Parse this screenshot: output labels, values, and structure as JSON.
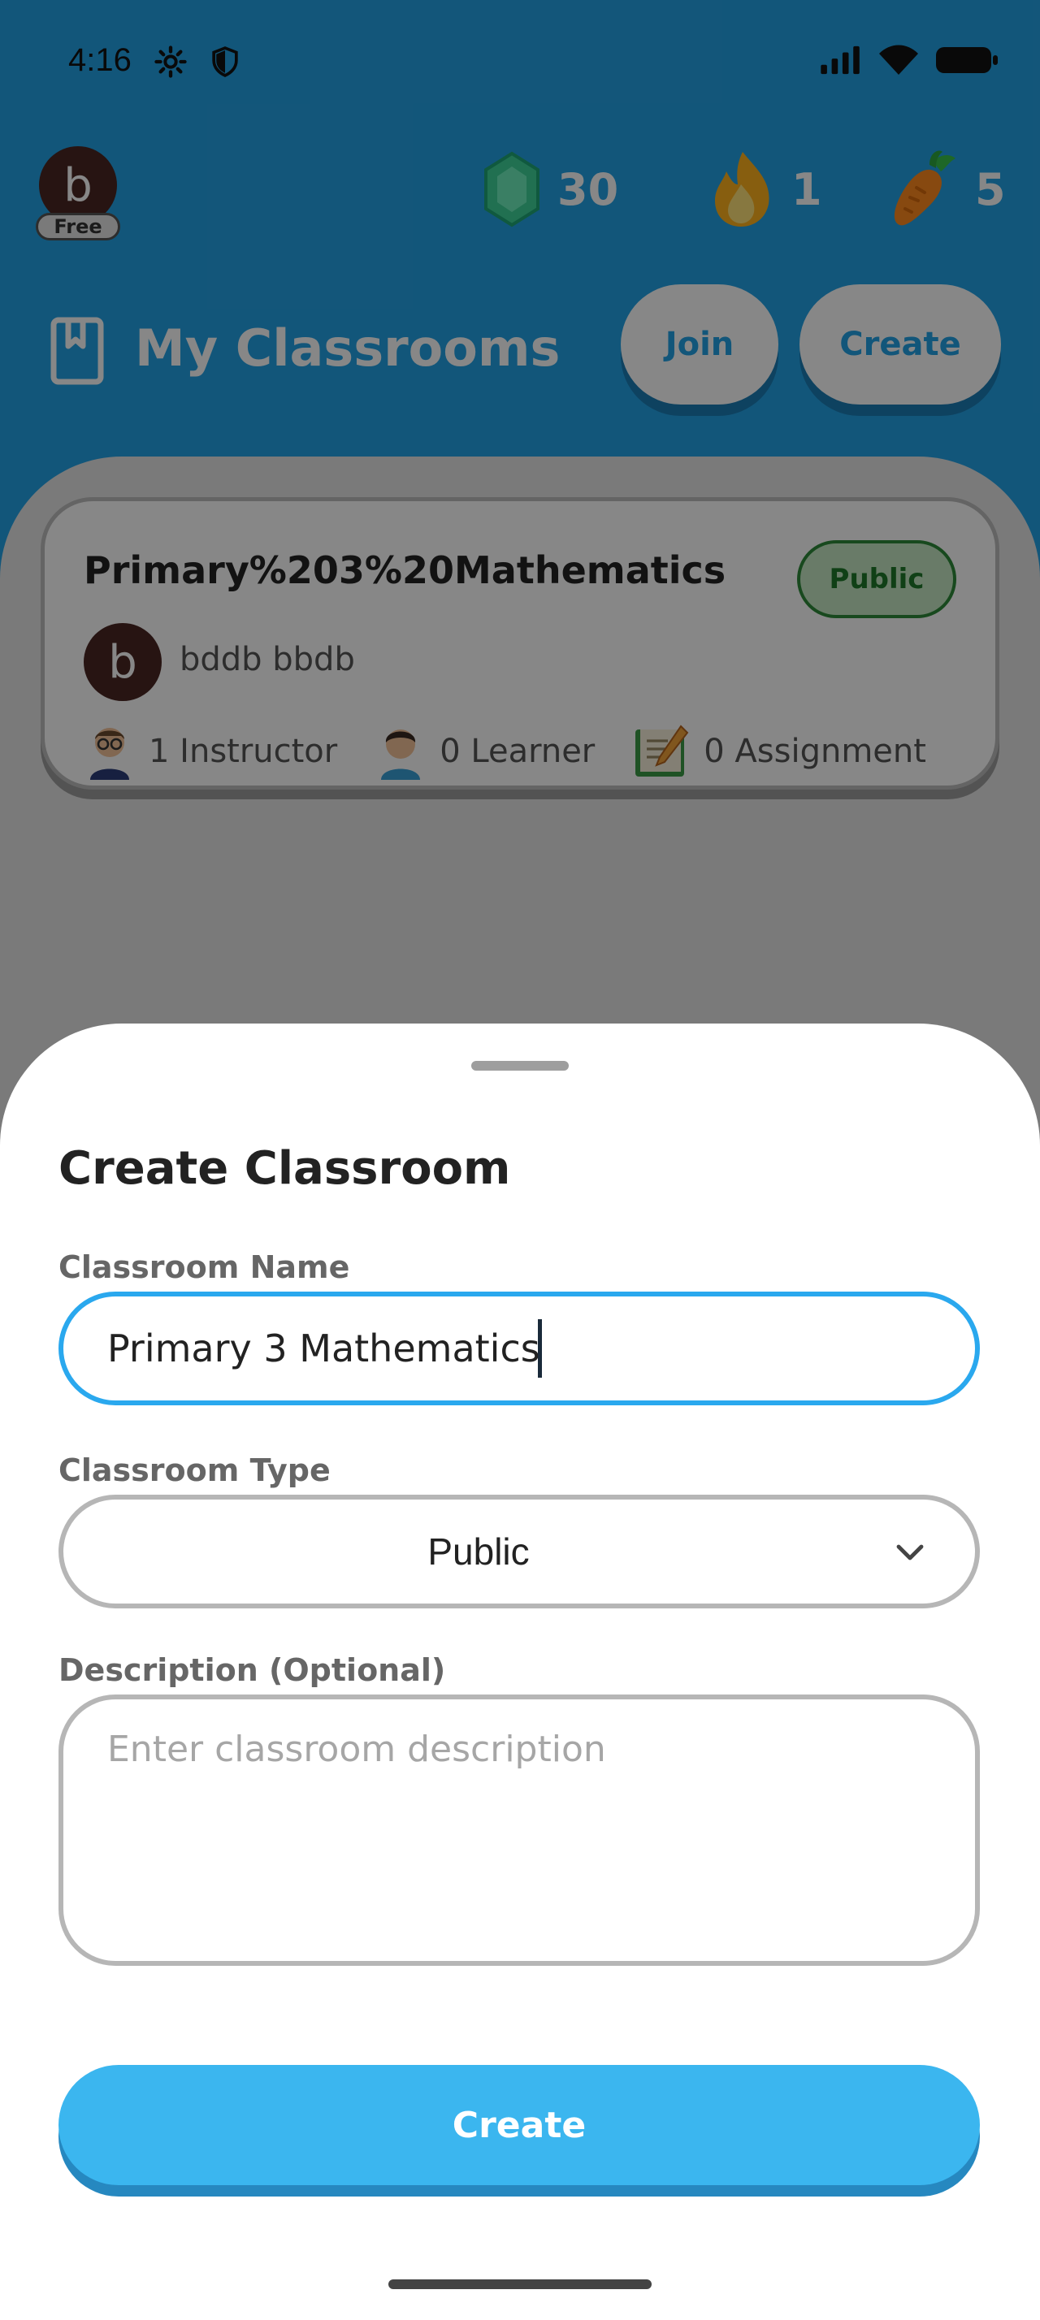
{
  "status_bar": {
    "time": "4:16"
  },
  "user": {
    "avatar_letter": "b",
    "plan_badge": "Free"
  },
  "stats": {
    "gems": "30",
    "streak": "1",
    "carrots": "5"
  },
  "header": {
    "title": "My Classrooms",
    "join_label": "Join",
    "create_label": "Create"
  },
  "classroom_card": {
    "name": "Primary%203%20Mathematics",
    "visibility": "Public",
    "owner_avatar_letter": "b",
    "owner_name": "bddb bbdb",
    "instructors": "1 Instructor",
    "learners": "0 Learner",
    "assignments": "0 Assignment"
  },
  "sheet": {
    "title": "Create Classroom",
    "name_label": "Classroom Name",
    "name_value": "Primary 3 Mathematics",
    "type_label": "Classroom Type",
    "type_value": "Public",
    "description_label": "Description (Optional)",
    "description_placeholder": "Enter classroom description",
    "submit_label": "Create"
  },
  "colors": {
    "accent": "#3bb6ef",
    "focus_border": "#2aa8ee",
    "public_green": "#2e8b3a"
  },
  "icons": [
    "gear-icon",
    "shield-icon",
    "signal-icon",
    "wifi-icon",
    "battery-icon",
    "gem-icon",
    "flame-icon",
    "carrot-icon",
    "book-icon",
    "instructor-icon",
    "learner-icon",
    "assignment-icon",
    "chevron-down-icon"
  ]
}
